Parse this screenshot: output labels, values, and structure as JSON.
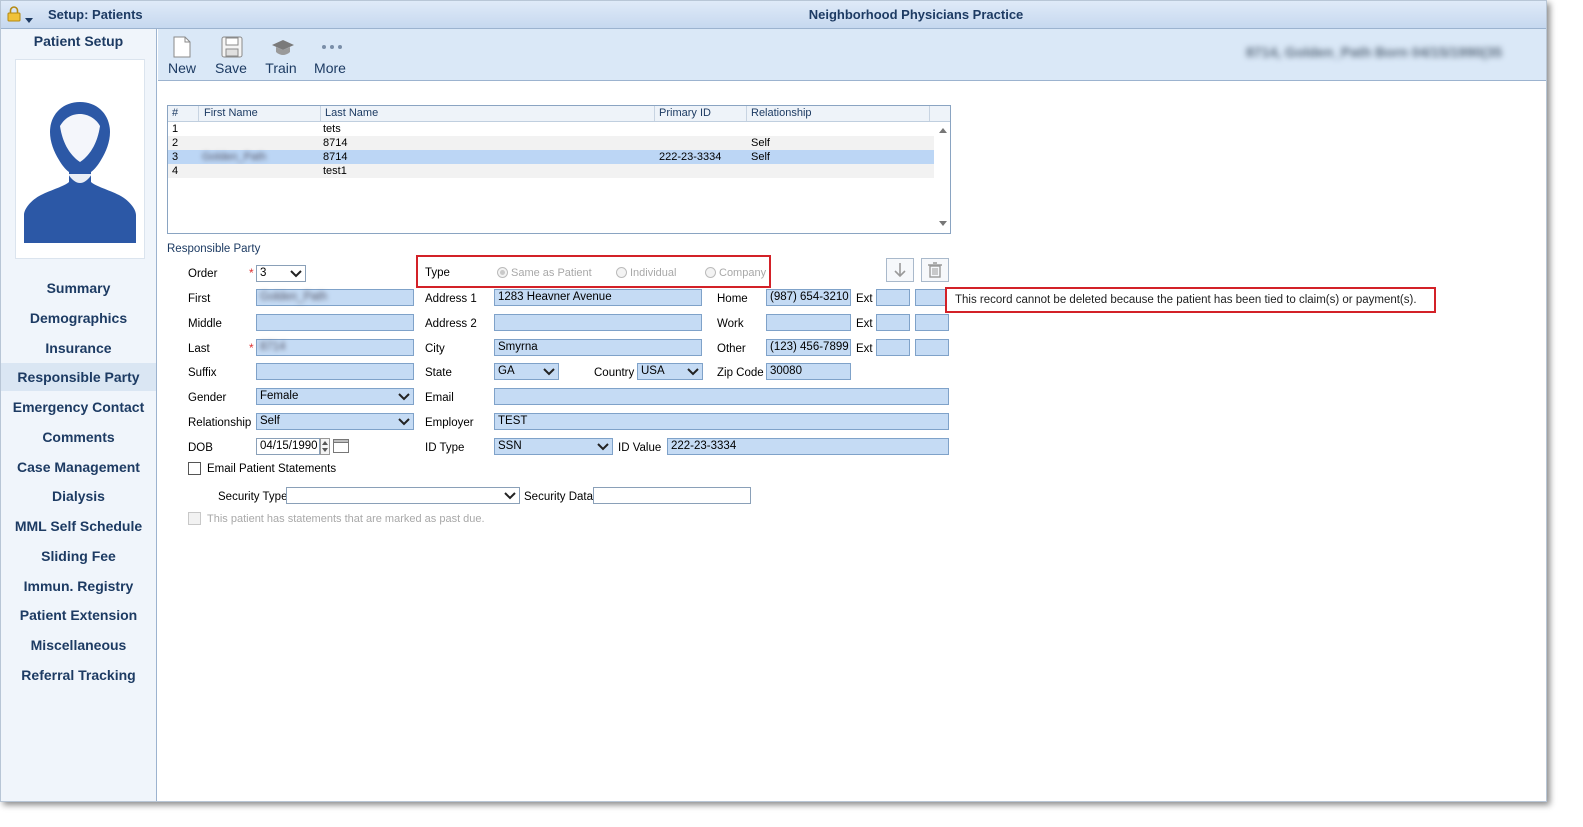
{
  "window": {
    "app_title": "Setup: Patients",
    "center_title": "Neighborhood Physicians Practice",
    "patient_header_blurred": "8714, Golden_Path  Born 04/15/1990(35"
  },
  "sidebar": {
    "title": "Patient Setup",
    "items": [
      {
        "label": "Summary"
      },
      {
        "label": "Demographics"
      },
      {
        "label": "Insurance"
      },
      {
        "label": "Responsible Party",
        "active": true
      },
      {
        "label": "Emergency Contact"
      },
      {
        "label": "Comments"
      },
      {
        "label": "Case Management"
      },
      {
        "label": "Dialysis"
      },
      {
        "label": "MML Self Schedule"
      },
      {
        "label": "Sliding Fee"
      },
      {
        "label": "Immun. Registry"
      },
      {
        "label": "Patient Extension"
      },
      {
        "label": "Miscellaneous"
      },
      {
        "label": "Referral Tracking"
      }
    ]
  },
  "toolbar": {
    "new_label": "New",
    "save_label": "Save",
    "train_label": "Train",
    "more_label": "More"
  },
  "grid": {
    "columns": [
      "#",
      "First Name",
      "Last Name",
      "Primary ID",
      "Relationship"
    ],
    "rows": [
      {
        "num": "1",
        "first": "",
        "last": "tets",
        "primary_id": "",
        "relationship": ""
      },
      {
        "num": "2",
        "first": "",
        "last": "8714",
        "primary_id": "",
        "relationship": "Self"
      },
      {
        "num": "3",
        "first": "Golden_Path",
        "last": "8714",
        "primary_id": "222-23-3334",
        "relationship": "Self",
        "selected": true
      },
      {
        "num": "4",
        "first": "",
        "last": "test1",
        "primary_id": "",
        "relationship": ""
      }
    ]
  },
  "form": {
    "section_title": "Responsible Party",
    "order_label": "Order",
    "order_value": "3",
    "first_label": "First",
    "first_value": "Golden_Path",
    "middle_label": "Middle",
    "middle_value": "",
    "last_label": "Last",
    "last_value": "8714",
    "suffix_label": "Suffix",
    "suffix_value": "",
    "gender_label": "Gender",
    "gender_value": "Female",
    "relationship_label": "Relationship",
    "relationship_value": "Self",
    "dob_label": "DOB",
    "dob_value": "04/15/1990",
    "email_statements_label": "Email Patient Statements",
    "type_label": "Type",
    "type_options": [
      "Same as Patient",
      "Individual",
      "Company"
    ],
    "type_selected": "Same as Patient",
    "address1_label": "Address 1",
    "address1_value": "1283 Heavner Avenue",
    "address2_label": "Address 2",
    "address2_value": "",
    "city_label": "City",
    "city_value": "Smyrna",
    "state_label": "State",
    "state_value": "GA",
    "country_label": "Country",
    "country_value": "USA",
    "zip_label": "Zip Code",
    "zip_value": "30080",
    "email_label": "Email",
    "email_value": "",
    "employer_label": "Employer",
    "employer_value": "TEST",
    "id_type_label": "ID Type",
    "id_type_value": "SSN",
    "id_value_label": "ID Value",
    "id_value_value": "222-23-3334",
    "home_label": "Home",
    "home_value": "(987) 654-3210",
    "work_label": "Work",
    "work_value": "",
    "other_label": "Other",
    "other_value": "(123) 456-7899",
    "ext_label": "Ext",
    "security_type_label": "Security Type",
    "security_type_value": "",
    "security_data_label": "Security Data",
    "security_data_value": "",
    "past_due_label": "This patient has statements that are marked as past due."
  },
  "tooltip": {
    "text": "This record cannot be deleted because the patient has been tied to claim(s) or payment(s)."
  }
}
